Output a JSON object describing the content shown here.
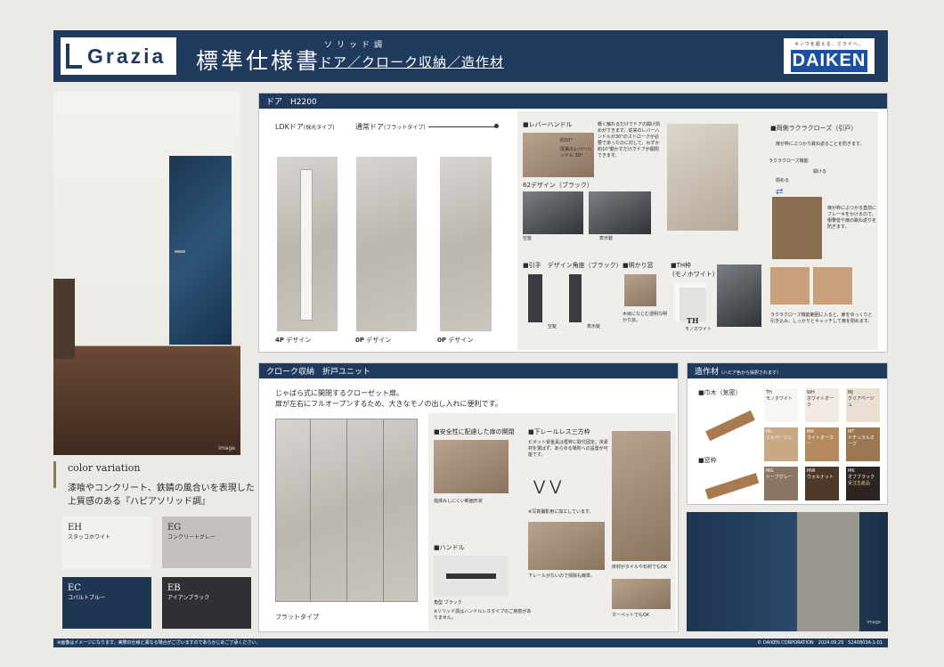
{
  "header": {
    "brand": "Grazia",
    "title": "標準仕様書",
    "sub_kana": "ソリッド調",
    "sub_title": "ドア／クローク収納／造作材",
    "maker_tag": "キノウを超える、ミライへ。",
    "maker": "DAIKEN"
  },
  "left": {
    "image_label": "image",
    "cv_label": "color variation",
    "cv_text": "漆喰やコンクリート、鉄錆の風合いを表現した上質感のある『ハピアソリッド調』",
    "swatches": [
      {
        "code": "EH",
        "name": "スタッコホワイト",
        "color": "#f3f1ec"
      },
      {
        "code": "EG",
        "name": "コンクリートグレー",
        "color": "#c4c0bb"
      },
      {
        "code": "EC",
        "name": "コバルトブルー",
        "color": "#1f3653"
      },
      {
        "code": "EB",
        "name": "アイアンブラック",
        "color": "#2e3033"
      }
    ]
  },
  "door": {
    "header": "ドア　H2200",
    "ldk": "LDKドア",
    "ldk_sub": "(採光タイプ)",
    "normal": "通常ドア",
    "normal_sub": "(フラットタイプ)",
    "d1": "4P",
    "d2": "0P",
    "d3": "0P",
    "design": "デザイン",
    "lever": "■レバーハンドル",
    "lever_text": "軽く触れるだけでドアの開け閉めができます。従来のレバーハンドルが30°のストロークが必要であったのに対して、わずか約10°動かすだけでドアが開閉できます。",
    "lever_angle_a": "約10°",
    "lever_angle_b": "従来のレバーハンドル 30°",
    "d62": "62デザイン（ブラック）",
    "kuu": "空錠",
    "hyoji": "表示錠",
    "hikite": "■引手　デザイン角座（ブラック）",
    "hikite_kuu": "空錠",
    "hikite_hyoji": "表示錠",
    "akari": "■明かり窓",
    "akari_text": "木目になじむ透明な明かり窓。",
    "th": "■TH枠",
    "th_sub": "(モノホワイト)",
    "th_code": "TH",
    "th_name": "モノホワイト",
    "ryo": "■両側ラクラクローズ（引戸）",
    "ryo_text": "扉が枠にぶつかり跳ね返ることを防ぎます。",
    "ryo_arrow_label": "ラクラクローズ機能",
    "ryo_close_a": "閉める",
    "ryo_close_b": "開ける",
    "ryo_side": "扉が枠にぶつかる直前にブレーキをかけるので、衝撃音や扉の跳ね返りを防ぎます。",
    "ryo_bottom": "ラクラクローズ機能範囲に入ると、扉をゆっくりと引き込み、しっかりとキャッチして扉を閉めます。"
  },
  "closet": {
    "header": "クローク収納　折戸ユニット",
    "text1": "じゃばら式に開閉するクローゼット扉。",
    "text2": "扉が左右にフルオープンするため、大きなモノの出し入れに便利です。",
    "flat": "フラットタイプ",
    "safe": "■安全性に配慮した扉の開閉",
    "safe_cap": "指挟みしにくい断面形状",
    "rail": "■下レールレス三方枠",
    "rail_text": "ピボット受金具は框枠に取付固定。床素材を選ばず、あらゆる場所への設置が可能です。",
    "rail_note": "※写真撮影用に加工しています。",
    "handle": "■ハンドル",
    "handle_cap": "角型 ブラック",
    "handle_note": "※ソリッド調はハンドルレスタイプのご用意がありません。",
    "floor": "下レールがないので掃除も簡単。",
    "tile": "床材がタイルや石材でもOK",
    "carpet": "カーペットでもOK"
  },
  "zousaku": {
    "header": "造作材",
    "header_note": "（ハピア色から採択されます）",
    "habaki": "■巾木（気密）",
    "madowaku": "■窓枠",
    "colors": [
      {
        "code": "TH",
        "name": "モノホワイト",
        "color": "#f7f6f3"
      },
      {
        "code": "WH",
        "name": "ホワイトオーク",
        "color": "#f1ebe4"
      },
      {
        "code": "MJ",
        "name": "クリアベージュ",
        "color": "#e9dfd2"
      },
      {
        "code": "ML",
        "name": "ミルベージュ",
        "color": "#c8a986"
      },
      {
        "code": "MA",
        "name": "ライトオーカー",
        "color": "#b48a5e"
      },
      {
        "code": "MT",
        "name": "ナチュラルオーク",
        "color": "#9c7650"
      },
      {
        "code": "MG",
        "name": "トープグレー",
        "color": "#8b7664"
      },
      {
        "code": "MW",
        "name": "ウォルナット",
        "color": "#4e3828"
      },
      {
        "code": "MK",
        "name": "オフブラック",
        "color": "#2b2420"
      }
    ],
    "mk_note": "受注生産品",
    "image_label": "image"
  },
  "footer": {
    "left": "※画像はイメージになります。実際の仕様と異なる場合がございますのであらかじめご了承ください。",
    "right": "© DAIKEN CORPORATION　2024.09.25　S240803A-1-01"
  }
}
